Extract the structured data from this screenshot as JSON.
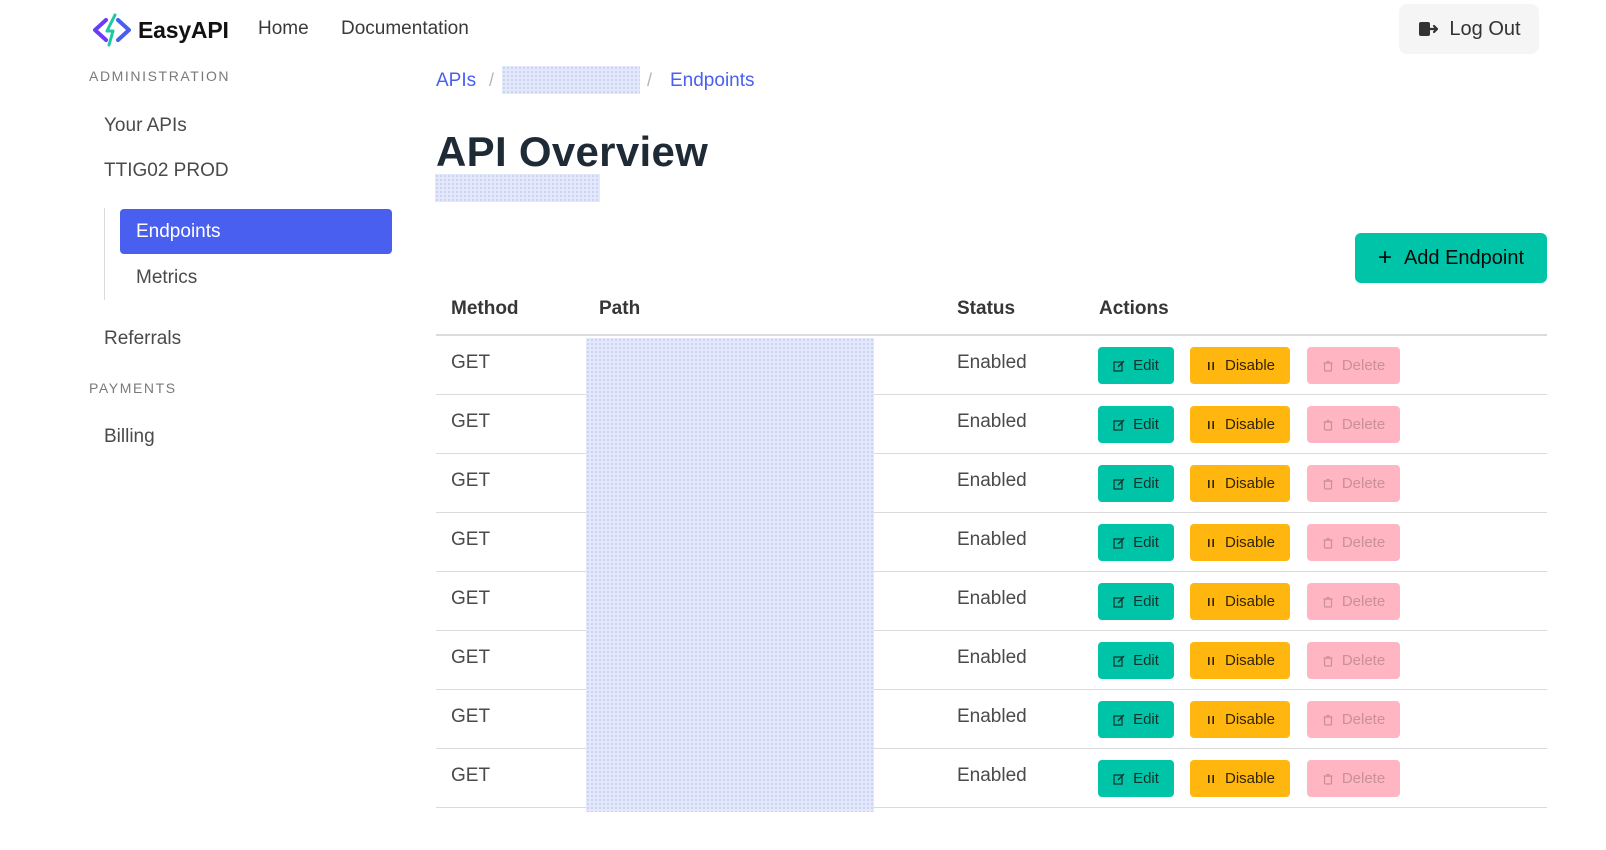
{
  "navbar": {
    "brand": "EasyAPI",
    "links": [
      "Home",
      "Documentation"
    ],
    "logout": "Log Out"
  },
  "sidebar": {
    "sections": [
      {
        "label": "ADMINISTRATION"
      },
      {
        "label": "PAYMENTS"
      }
    ],
    "items": [
      "Your APIs",
      "TTIG02 PROD",
      "Referrals",
      "Billing"
    ],
    "submenu": [
      "Endpoints",
      "Metrics"
    ]
  },
  "breadcrumb": {
    "first": "APIs",
    "separator": "/",
    "last": "Endpoints"
  },
  "page": {
    "title": "API Overview",
    "add_button": "Add Endpoint"
  },
  "table": {
    "headers": [
      "Method",
      "Path",
      "Status",
      "Actions"
    ],
    "rows": [
      {
        "method": "GET",
        "status": "Enabled"
      },
      {
        "method": "GET",
        "status": "Enabled"
      },
      {
        "method": "GET",
        "status": "Enabled"
      },
      {
        "method": "GET",
        "status": "Enabled"
      },
      {
        "method": "GET",
        "status": "Enabled"
      },
      {
        "method": "GET",
        "status": "Enabled"
      },
      {
        "method": "GET",
        "status": "Enabled"
      },
      {
        "method": "GET",
        "status": "Enabled"
      }
    ],
    "actions": {
      "edit": "Edit",
      "disable": "Disable",
      "delete": "Delete"
    }
  },
  "colors": {
    "primary": "#485fef",
    "success": "#00c4a7",
    "warning": "#ffb70f",
    "danger_light": "#ffb6c2"
  },
  "icons": {
    "logo": "easyapi-logo-icon",
    "logout": "logout-icon",
    "add": "plus-icon",
    "edit": "edit-icon",
    "disable": "pause-icon",
    "delete": "trash-icon"
  }
}
